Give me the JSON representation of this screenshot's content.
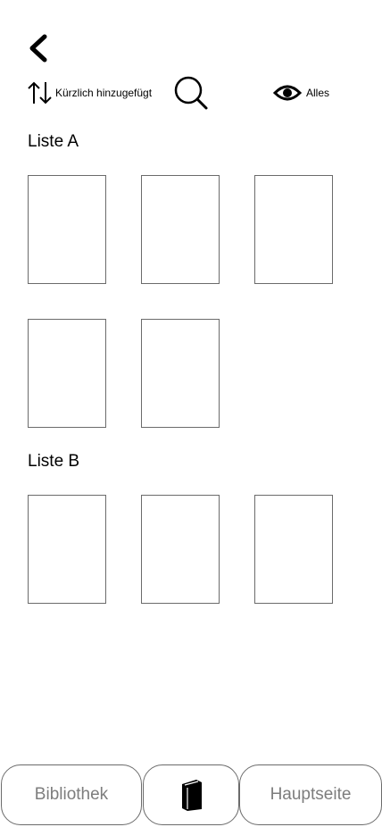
{
  "header": {
    "back_icon": "chevron-left-icon"
  },
  "toolbar": {
    "sort": {
      "icon": "sort-arrows-icon",
      "label": "Kürzlich hinzugefügt"
    },
    "search": {
      "icon": "search-icon"
    },
    "filter": {
      "icon": "eye-icon",
      "label": "Alles"
    }
  },
  "lists": [
    {
      "title": "Liste A",
      "book_count": 5
    },
    {
      "title": "Liste B",
      "book_count": 3
    }
  ],
  "bottom_nav": {
    "left_label": "Bibliothek",
    "center_icon": "book-icon",
    "right_label": "Hauptseite"
  },
  "colors": {
    "border": "#6b6b6b",
    "nav_text": "#7d7d7d",
    "icon": "#000000"
  }
}
